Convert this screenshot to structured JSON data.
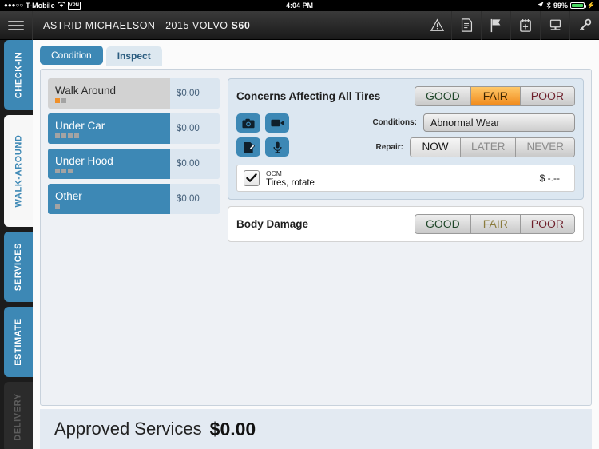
{
  "status_bar": {
    "signal_dots": "●●●○○",
    "carrier": "T-Mobile",
    "wifi_icon": "wifi-icon",
    "vpn_badge": "VPN",
    "time": "4:04 PM",
    "location_icon": "location-arrow-icon",
    "bluetooth_icon": "bluetooth-icon",
    "battery_percent": "99%"
  },
  "header": {
    "menu_icon": "hamburger-menu-icon",
    "customer": "ASTRID MICHAELSON",
    "separator": "-",
    "vehicle_year_make": "2015 VOLVO",
    "vehicle_model": "S60",
    "toolbar": [
      {
        "name": "warning-icon",
        "label": "Alerts"
      },
      {
        "name": "document-icon",
        "label": "Documents"
      },
      {
        "name": "flag-icon",
        "label": "Flag"
      },
      {
        "name": "add-note-icon",
        "label": "Add Note"
      },
      {
        "name": "workstation-icon",
        "label": "Workstation"
      },
      {
        "name": "key-icon",
        "label": "Keys"
      }
    ]
  },
  "sidebar": {
    "items": [
      {
        "label": "CHECK-IN",
        "state": "enabled"
      },
      {
        "label": "WALK-AROUND",
        "state": "active"
      },
      {
        "label": "SERVICES",
        "state": "enabled"
      },
      {
        "label": "ESTIMATE",
        "state": "enabled"
      },
      {
        "label": "DELIVERY",
        "state": "disabled"
      }
    ]
  },
  "tabs": [
    {
      "label": "Condition",
      "state": "inactive"
    },
    {
      "label": "Inspect",
      "state": "active"
    }
  ],
  "areas": [
    {
      "label": "Walk Around",
      "price": "$0.00",
      "selected": true,
      "dots": [
        "orange",
        "gray"
      ]
    },
    {
      "label": "Under Car",
      "price": "$0.00",
      "selected": false,
      "dots": [
        "gray",
        "gray",
        "gray",
        "gray"
      ]
    },
    {
      "label": "Under Hood",
      "price": "$0.00",
      "selected": false,
      "dots": [
        "gray",
        "gray",
        "gray"
      ]
    },
    {
      "label": "Other",
      "price": "$0.00",
      "selected": false,
      "dots": [
        "gray"
      ]
    }
  ],
  "inspection": {
    "tires": {
      "title": "Concerns Affecting All Tires",
      "rating": {
        "options": [
          "GOOD",
          "FAIR",
          "POOR"
        ],
        "selected": "FAIR"
      },
      "media_buttons": [
        {
          "name": "camera-icon",
          "label": "Photo"
        },
        {
          "name": "video-icon",
          "label": "Video"
        },
        {
          "name": "note-edit-icon",
          "label": "Note"
        },
        {
          "name": "microphone-icon",
          "label": "Voice"
        }
      ],
      "conditions_label": "Conditions:",
      "conditions_value": "Abnormal Wear",
      "repair_label": "Repair:",
      "repair": {
        "options": [
          "NOW",
          "LATER",
          "NEVER"
        ],
        "selected": "NOW"
      },
      "service": {
        "checked": true,
        "code": "OCM",
        "name": "Tires, rotate",
        "price": "$ -.--"
      }
    },
    "body_damage": {
      "title": "Body Damage",
      "rating": {
        "options": [
          "GOOD",
          "FAIR",
          "POOR"
        ],
        "selected": ""
      }
    }
  },
  "footer": {
    "label": "Approved Services",
    "amount": "$0.00"
  },
  "colors": {
    "accent_blue": "#3d88b5",
    "selected_orange": "#f08a1c",
    "panel_bg": "#eef1f5",
    "good_green": "#1e4628",
    "poor_red": "#6e1f2b"
  }
}
